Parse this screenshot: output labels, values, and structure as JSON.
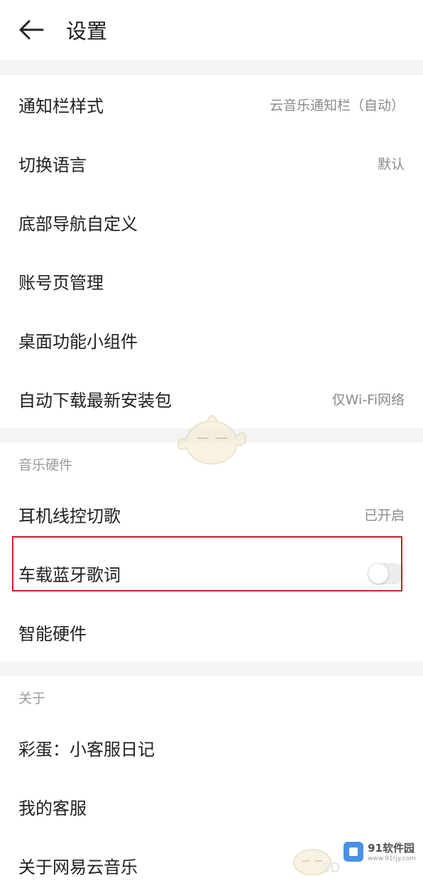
{
  "header": {
    "title": "设置",
    "back_icon": "arrow-left-icon"
  },
  "section_general": {
    "items": [
      {
        "label": "通知栏样式",
        "value": "云音乐通知栏（自动）"
      },
      {
        "label": "切换语言",
        "value": "默认"
      },
      {
        "label": "底部导航自定义",
        "value": ""
      },
      {
        "label": "账号页管理",
        "value": ""
      },
      {
        "label": "桌面功能小组件",
        "value": ""
      },
      {
        "label": "自动下载最新安装包",
        "value": "仅Wi-Fi网络"
      }
    ]
  },
  "section_hardware": {
    "header": "音乐硬件",
    "items": [
      {
        "label": "耳机线控切歌",
        "value": "已开启"
      },
      {
        "label": "车载蓝牙歌词",
        "toggle_on": false
      },
      {
        "label": "智能硬件",
        "value": ""
      }
    ]
  },
  "section_about": {
    "header": "关于",
    "items": [
      {
        "label": "彩蛋：小客服日记"
      },
      {
        "label": "我的客服"
      },
      {
        "label": "关于网易云音乐"
      }
    ]
  },
  "watermark": {
    "brand": "91软件园",
    "sub": "www.91rjy.com",
    "faint_text": "3D"
  },
  "colors": {
    "highlight_border": "#c6202b",
    "background": "#f4f4f4",
    "value_text": "#8a8a8a"
  }
}
